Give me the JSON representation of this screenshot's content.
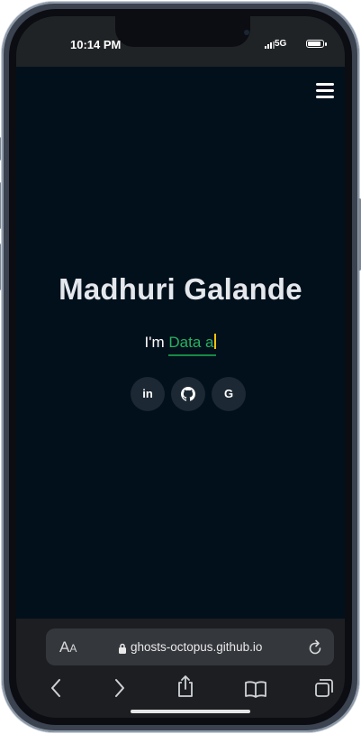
{
  "status": {
    "time": "10:14 PM",
    "network": "5G",
    "battery_fraction": 0.9
  },
  "header": {
    "menu_icon": "hamburger-menu-icon"
  },
  "hero": {
    "name": "Madhuri Galande",
    "prefix": "I'm ",
    "typed_text": "Data a",
    "accent_color": "#2ab15f",
    "cursor_color": "#f4c20d"
  },
  "social": [
    {
      "name": "linkedin",
      "label": "in",
      "icon": "linkedin-icon"
    },
    {
      "name": "github",
      "icon": "github-icon"
    },
    {
      "name": "google",
      "label": "G",
      "icon": "google-icon"
    }
  ],
  "browser": {
    "text_size_label_large": "A",
    "text_size_label_small": "A",
    "url": "ghosts-octopus.github.io",
    "toolbar": [
      "back-icon",
      "forward-icon",
      "share-icon",
      "bookmarks-icon",
      "tabs-icon"
    ]
  }
}
